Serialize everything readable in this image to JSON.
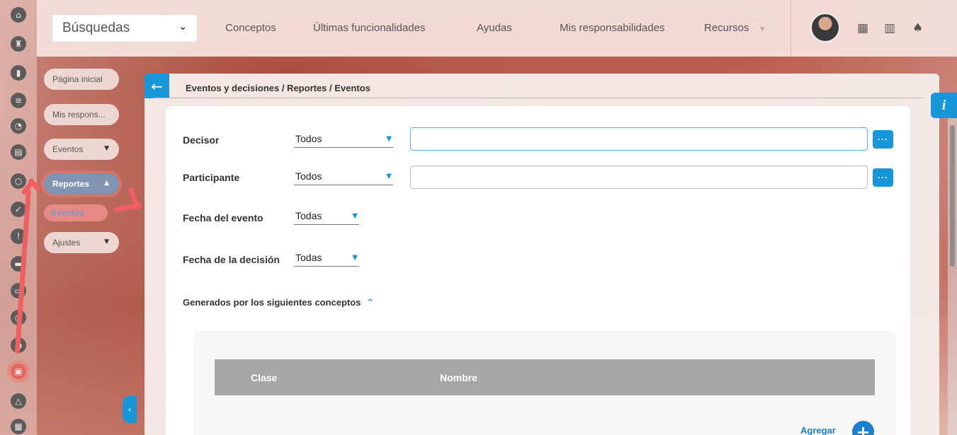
{
  "topbar": {
    "search_label": "Búsquedas",
    "nav": [
      {
        "label": "Conceptos"
      },
      {
        "label": "Últimas funcionalidades"
      },
      {
        "label": "Ayudas"
      },
      {
        "label": "Mis responsabilidades"
      },
      {
        "label": "Recursos"
      }
    ]
  },
  "subnav": {
    "pagina_inicial": "Página inicial",
    "mis_respons": "Mis respons...",
    "eventos_group": "Eventos",
    "reportes": "Reportes",
    "eventos_item": "Eventos",
    "ajustes": "Ajustes"
  },
  "panel": {
    "breadcrumb": "Eventos y decisiones / Reportes / Eventos"
  },
  "form": {
    "decisor_label": "Decisor",
    "decisor_value": "Todos",
    "participante_label": "Participante",
    "participante_value": "Todos",
    "fecha_evento_label": "Fecha del evento",
    "fecha_evento_value": "Todas",
    "fecha_decision_label": "Fecha de la decisión",
    "fecha_decision_value": "Todas",
    "dots": "···"
  },
  "concepts": {
    "heading": "Generados por los siguientes conceptos",
    "columns": [
      "Clase",
      "Nombre"
    ],
    "add_label": "Agregar"
  },
  "colors": {
    "accent": "#1796d9",
    "annotation": "#ef5f61"
  }
}
